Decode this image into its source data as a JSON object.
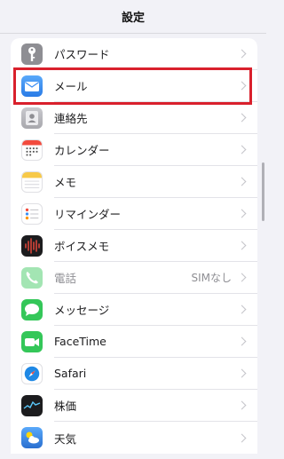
{
  "header": {
    "title": "設定"
  },
  "rows": [
    {
      "label": "パスワード",
      "icon": "key-icon",
      "color": "#8e8e93"
    },
    {
      "label": "メール",
      "icon": "mail-icon",
      "color": "#3d8ff5"
    },
    {
      "label": "連絡先",
      "icon": "contacts-icon",
      "color": "#a8a8ad"
    },
    {
      "label": "カレンダー",
      "icon": "calendar-icon",
      "color": "#ffffff"
    },
    {
      "label": "メモ",
      "icon": "notes-icon",
      "color": "#f7c948"
    },
    {
      "label": "リマインダー",
      "icon": "reminders-icon",
      "color": "#ffffff"
    },
    {
      "label": "ボイスメモ",
      "icon": "voice-memo-icon",
      "color": "#1c1c1e"
    },
    {
      "label": "電話",
      "detail": "SIMなし",
      "icon": "phone-icon",
      "color": "#34c759",
      "dimmed": true
    },
    {
      "label": "メッセージ",
      "icon": "messages-icon",
      "color": "#34c759"
    },
    {
      "label": "FaceTime",
      "icon": "facetime-icon",
      "color": "#34c759"
    },
    {
      "label": "Safari",
      "icon": "safari-icon",
      "color": "#1e88e5"
    },
    {
      "label": "株価",
      "icon": "stocks-icon",
      "color": "#1c1c1e"
    },
    {
      "label": "天気",
      "icon": "weather-icon",
      "color": "#3b8de0"
    }
  ],
  "highlight_color": "#d9202c"
}
